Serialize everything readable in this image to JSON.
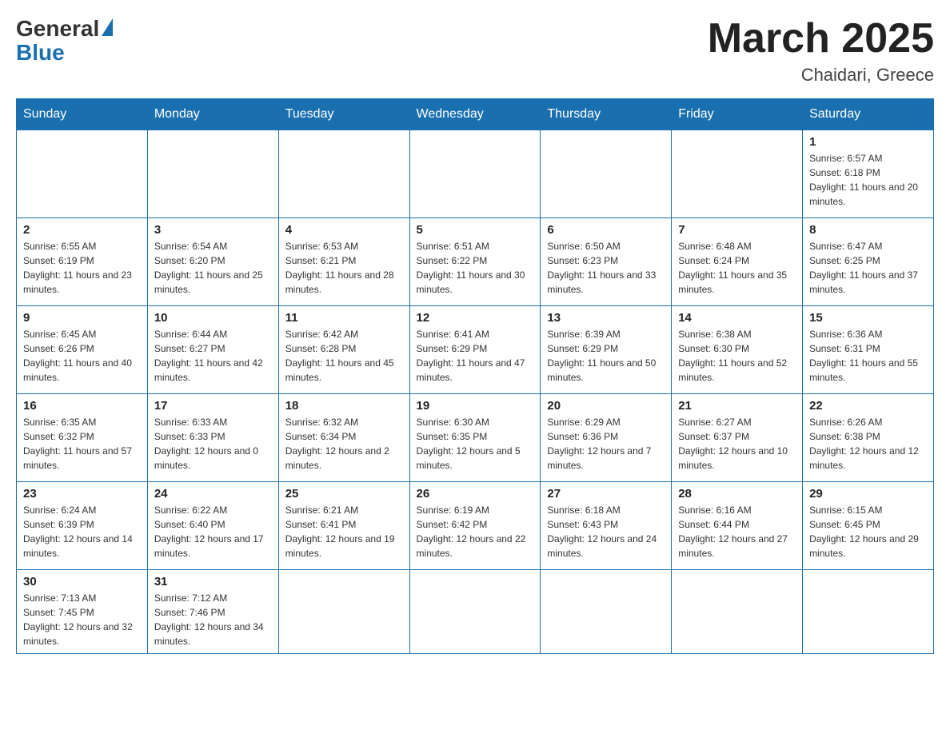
{
  "header": {
    "logo_general": "General",
    "logo_blue": "Blue",
    "title": "March 2025",
    "location": "Chaidari, Greece"
  },
  "days_of_week": [
    "Sunday",
    "Monday",
    "Tuesday",
    "Wednesday",
    "Thursday",
    "Friday",
    "Saturday"
  ],
  "weeks": [
    [
      {
        "day": "",
        "info": ""
      },
      {
        "day": "",
        "info": ""
      },
      {
        "day": "",
        "info": ""
      },
      {
        "day": "",
        "info": ""
      },
      {
        "day": "",
        "info": ""
      },
      {
        "day": "",
        "info": ""
      },
      {
        "day": "1",
        "info": "Sunrise: 6:57 AM\nSunset: 6:18 PM\nDaylight: 11 hours and 20 minutes."
      }
    ],
    [
      {
        "day": "2",
        "info": "Sunrise: 6:55 AM\nSunset: 6:19 PM\nDaylight: 11 hours and 23 minutes."
      },
      {
        "day": "3",
        "info": "Sunrise: 6:54 AM\nSunset: 6:20 PM\nDaylight: 11 hours and 25 minutes."
      },
      {
        "day": "4",
        "info": "Sunrise: 6:53 AM\nSunset: 6:21 PM\nDaylight: 11 hours and 28 minutes."
      },
      {
        "day": "5",
        "info": "Sunrise: 6:51 AM\nSunset: 6:22 PM\nDaylight: 11 hours and 30 minutes."
      },
      {
        "day": "6",
        "info": "Sunrise: 6:50 AM\nSunset: 6:23 PM\nDaylight: 11 hours and 33 minutes."
      },
      {
        "day": "7",
        "info": "Sunrise: 6:48 AM\nSunset: 6:24 PM\nDaylight: 11 hours and 35 minutes."
      },
      {
        "day": "8",
        "info": "Sunrise: 6:47 AM\nSunset: 6:25 PM\nDaylight: 11 hours and 37 minutes."
      }
    ],
    [
      {
        "day": "9",
        "info": "Sunrise: 6:45 AM\nSunset: 6:26 PM\nDaylight: 11 hours and 40 minutes."
      },
      {
        "day": "10",
        "info": "Sunrise: 6:44 AM\nSunset: 6:27 PM\nDaylight: 11 hours and 42 minutes."
      },
      {
        "day": "11",
        "info": "Sunrise: 6:42 AM\nSunset: 6:28 PM\nDaylight: 11 hours and 45 minutes."
      },
      {
        "day": "12",
        "info": "Sunrise: 6:41 AM\nSunset: 6:29 PM\nDaylight: 11 hours and 47 minutes."
      },
      {
        "day": "13",
        "info": "Sunrise: 6:39 AM\nSunset: 6:29 PM\nDaylight: 11 hours and 50 minutes."
      },
      {
        "day": "14",
        "info": "Sunrise: 6:38 AM\nSunset: 6:30 PM\nDaylight: 11 hours and 52 minutes."
      },
      {
        "day": "15",
        "info": "Sunrise: 6:36 AM\nSunset: 6:31 PM\nDaylight: 11 hours and 55 minutes."
      }
    ],
    [
      {
        "day": "16",
        "info": "Sunrise: 6:35 AM\nSunset: 6:32 PM\nDaylight: 11 hours and 57 minutes."
      },
      {
        "day": "17",
        "info": "Sunrise: 6:33 AM\nSunset: 6:33 PM\nDaylight: 12 hours and 0 minutes."
      },
      {
        "day": "18",
        "info": "Sunrise: 6:32 AM\nSunset: 6:34 PM\nDaylight: 12 hours and 2 minutes."
      },
      {
        "day": "19",
        "info": "Sunrise: 6:30 AM\nSunset: 6:35 PM\nDaylight: 12 hours and 5 minutes."
      },
      {
        "day": "20",
        "info": "Sunrise: 6:29 AM\nSunset: 6:36 PM\nDaylight: 12 hours and 7 minutes."
      },
      {
        "day": "21",
        "info": "Sunrise: 6:27 AM\nSunset: 6:37 PM\nDaylight: 12 hours and 10 minutes."
      },
      {
        "day": "22",
        "info": "Sunrise: 6:26 AM\nSunset: 6:38 PM\nDaylight: 12 hours and 12 minutes."
      }
    ],
    [
      {
        "day": "23",
        "info": "Sunrise: 6:24 AM\nSunset: 6:39 PM\nDaylight: 12 hours and 14 minutes."
      },
      {
        "day": "24",
        "info": "Sunrise: 6:22 AM\nSunset: 6:40 PM\nDaylight: 12 hours and 17 minutes."
      },
      {
        "day": "25",
        "info": "Sunrise: 6:21 AM\nSunset: 6:41 PM\nDaylight: 12 hours and 19 minutes."
      },
      {
        "day": "26",
        "info": "Sunrise: 6:19 AM\nSunset: 6:42 PM\nDaylight: 12 hours and 22 minutes."
      },
      {
        "day": "27",
        "info": "Sunrise: 6:18 AM\nSunset: 6:43 PM\nDaylight: 12 hours and 24 minutes."
      },
      {
        "day": "28",
        "info": "Sunrise: 6:16 AM\nSunset: 6:44 PM\nDaylight: 12 hours and 27 minutes."
      },
      {
        "day": "29",
        "info": "Sunrise: 6:15 AM\nSunset: 6:45 PM\nDaylight: 12 hours and 29 minutes."
      }
    ],
    [
      {
        "day": "30",
        "info": "Sunrise: 7:13 AM\nSunset: 7:45 PM\nDaylight: 12 hours and 32 minutes."
      },
      {
        "day": "31",
        "info": "Sunrise: 7:12 AM\nSunset: 7:46 PM\nDaylight: 12 hours and 34 minutes."
      },
      {
        "day": "",
        "info": ""
      },
      {
        "day": "",
        "info": ""
      },
      {
        "day": "",
        "info": ""
      },
      {
        "day": "",
        "info": ""
      },
      {
        "day": "",
        "info": ""
      }
    ]
  ]
}
